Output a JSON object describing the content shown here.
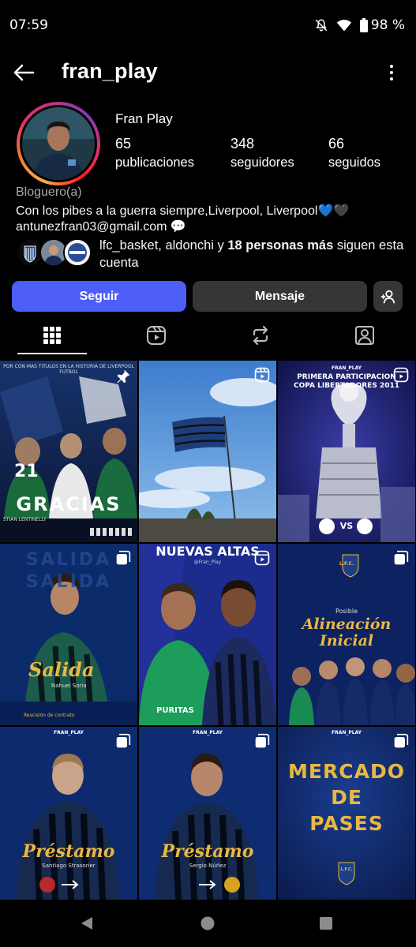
{
  "status_bar": {
    "time": "07:59",
    "battery": "98 %",
    "icons": [
      "mute-icon",
      "wifi-icon",
      "battery-icon"
    ]
  },
  "header": {
    "username": "fran_play",
    "back_icon": "back-arrow-icon",
    "more_icon": "more-vertical-icon"
  },
  "profile": {
    "display_name": "Fran Play",
    "stats": [
      {
        "value": "65",
        "label": "publicaciones"
      },
      {
        "value": "348",
        "label": "seguidores"
      },
      {
        "value": "66",
        "label": "seguidos"
      }
    ],
    "category": "Bloguero(a)",
    "bio_line": "Con los pibes a la guerra siempre,Liverpool, Liverpool",
    "bio_emojis": [
      "💙",
      "🖤"
    ],
    "email": "antunezfran03@gmail.com",
    "email_emoji": "💬",
    "followed_by": {
      "names": "lfc_basket, aldonchi y ",
      "count_text": "18 personas más",
      "suffix": " siguen esta cuenta"
    }
  },
  "actions": {
    "follow": "Seguir",
    "message": "Mensaje",
    "add_user_icon": "add-person-icon"
  },
  "tabs": [
    {
      "name": "grid-icon",
      "active": true
    },
    {
      "name": "reels-icon",
      "active": false
    },
    {
      "name": "reposts-icon",
      "active": false
    },
    {
      "name": "tagged-icon",
      "active": false
    }
  ],
  "posts": [
    {
      "text": "GRACIAS",
      "top_text": "POR CON MAS TITULOS EN LA HISTORIA DE LIVERPOOL FUTBOL",
      "number": "21",
      "bottom_text": "STIAN LENTINELLY",
      "icon": "pin-icon"
    },
    {
      "icon": "reel-icon"
    },
    {
      "top_text": "PRIMERA PARTICIPACION\nCOPA LIBERTADORES 2011",
      "brand": "FRAN_PLAY",
      "vs": "VS",
      "icon": "reel-icon"
    },
    {
      "text": "Salida",
      "name": "Nahuel Soria",
      "sub": "Rescisión de contrato",
      "bg_word": "SALIDA",
      "icon": "carousel-icon"
    },
    {
      "text": "NUEVAS ALTAS",
      "sub": "@Fran_Play",
      "sponsor": "PURITAS",
      "icon": "reel-icon"
    },
    {
      "small": "Posible",
      "text": "Alineación\nInicial",
      "crest": "L.F.C.",
      "icon": "carousel-icon"
    },
    {
      "text": "Préstamo",
      "name": "Santiago Strasorier",
      "brand": "FRAN_PLAY",
      "icon": "carousel-icon"
    },
    {
      "text": "Préstamo",
      "name": "Sergio Núñez",
      "brand": "FRAN_PLAY",
      "icon": "carousel-icon"
    },
    {
      "text": "MERCADO\nDE\nPASES",
      "brand": "FRAN_PLAY",
      "crest": "L.F.C.",
      "icon": "carousel-icon"
    }
  ],
  "colors": {
    "accent": "#4d5ef6",
    "secondary_button": "#363636",
    "muted_text": "#a8a8a8",
    "gold": "#e8b842"
  }
}
